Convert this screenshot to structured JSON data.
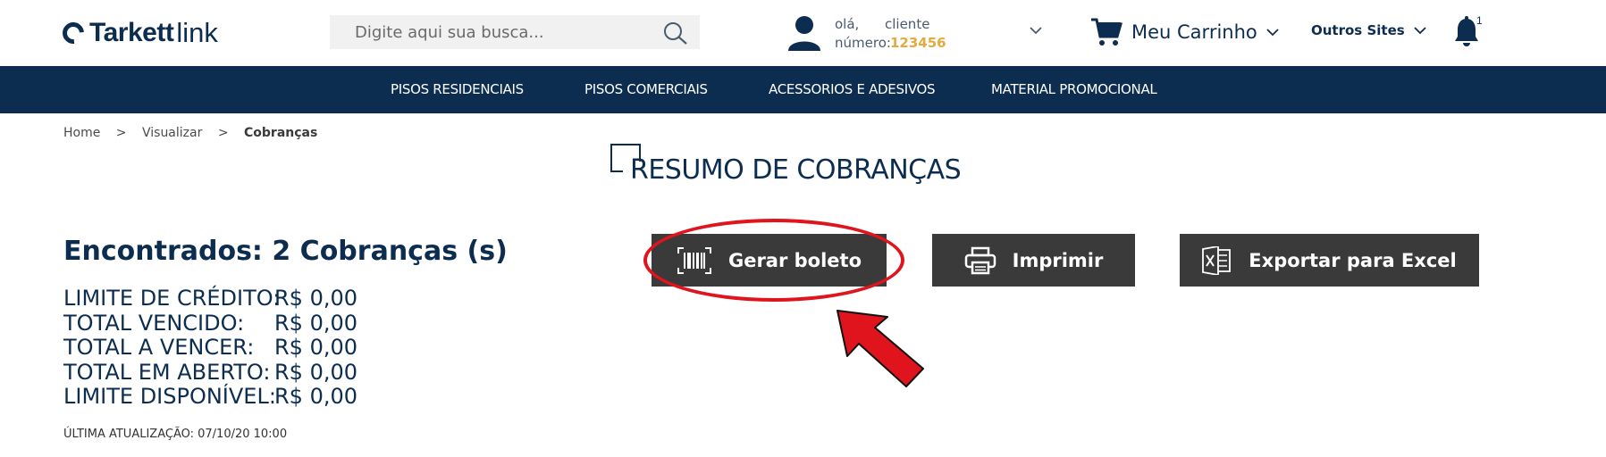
{
  "header": {
    "logo_text": "Tarkett",
    "logo_suffix": "link",
    "search": {
      "placeholder": "Digite aqui sua busca..."
    },
    "user": {
      "greeting": "olá,",
      "name": "cliente",
      "number_label": "número:",
      "number": "123456"
    },
    "cart_label": "Meu Carrinho",
    "other_sites_label": "Outros Sites",
    "notifications_count": "1"
  },
  "nav": {
    "items": [
      {
        "label": "PISOS RESIDENCIAIS"
      },
      {
        "label": "PISOS COMERCIAIS"
      },
      {
        "label": "ACESSORIOS E ADESIVOS"
      },
      {
        "label": "MATERIAL PROMOCIONAL"
      }
    ]
  },
  "breadcrumb": {
    "items": [
      "Home",
      "Visualizar",
      "Cobranças"
    ],
    "separator": ">"
  },
  "page": {
    "title": "RESUMO DE COBRANÇAS",
    "found_text": "Encontrados: 2 Cobranças (s)",
    "summary": [
      {
        "label": "LIMITE DE CRÉDITO:",
        "value": "R$ 0,00"
      },
      {
        "label": "TOTAL VENCIDO:",
        "value": "R$ 0,00"
      },
      {
        "label": "TOTAL A VENCER:",
        "value": "R$ 0,00"
      },
      {
        "label": "TOTAL EM ABERTO:",
        "value": "R$ 0,00"
      },
      {
        "label": "LIMITE DISPONÍVEL:",
        "value": "R$ 0,00"
      }
    ],
    "last_update": "ÚLTIMA ATUALIZAÇÃO: 07/10/20 10:00"
  },
  "actions": {
    "generate_boleto": "Gerar boleto",
    "print": "Imprimir",
    "export_excel": "Exportar para Excel"
  },
  "colors": {
    "brand_navy": "#0c2d4f",
    "button_bg": "#3a3a3a",
    "accent_number": "#e5a93d",
    "annotation_red": "#e0141c"
  }
}
